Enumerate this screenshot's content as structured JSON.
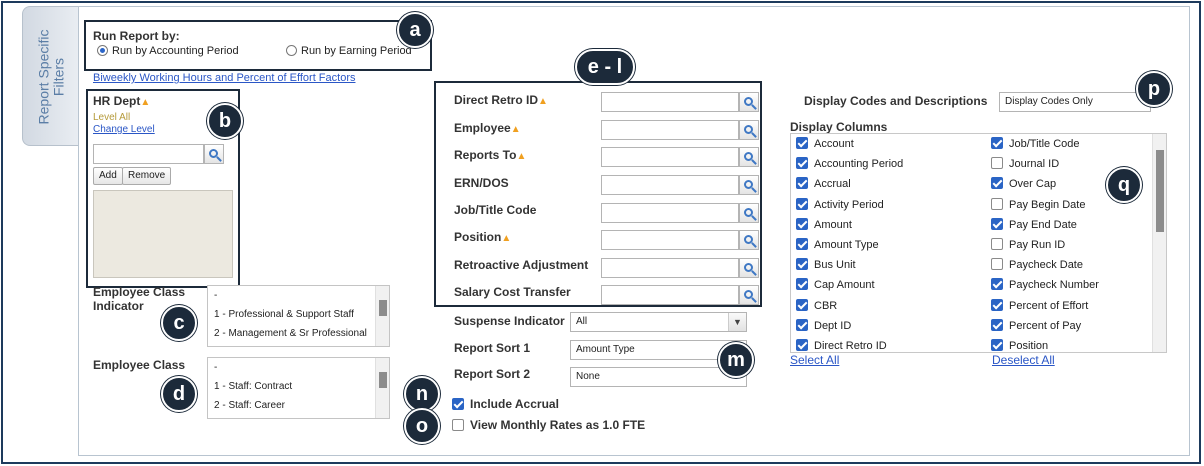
{
  "side_tab": {
    "label": "Report Specific\nFilters"
  },
  "run_report": {
    "title": "Run Report by:",
    "options": [
      "Run by Accounting Period",
      "Run by Earning Period"
    ],
    "selected": 0
  },
  "factors_link": "Biweekly Working Hours and Percent of Effort Factors",
  "hr_dept": {
    "label": "HR Dept",
    "warn": "▲",
    "level_text": "Level All",
    "change_level": "Change Level",
    "input_value": "",
    "add_label": "Add",
    "remove_label": "Remove"
  },
  "employee_class_indicator": {
    "label": "Employee Class Indicator",
    "options": [
      "-",
      "1 - Professional & Support Staff",
      "2 - Management & Sr Professional"
    ]
  },
  "employee_class": {
    "label": "Employee Class",
    "options": [
      "-",
      "1 - Staff: Contract",
      "2 - Staff: Career"
    ]
  },
  "fields": [
    {
      "label": "Direct Retro ID",
      "warn": "▲",
      "value": ""
    },
    {
      "label": "Employee",
      "warn": "▲",
      "value": ""
    },
    {
      "label": "Reports To",
      "warn": "▲",
      "value": ""
    },
    {
      "label": "ERN/DOS",
      "warn": "",
      "value": ""
    },
    {
      "label": "Job/Title Code",
      "warn": "",
      "value": ""
    },
    {
      "label": "Position",
      "warn": "▲",
      "value": ""
    },
    {
      "label": "Retroactive Adjustment",
      "warn": "",
      "value": ""
    },
    {
      "label": "Salary Cost Transfer",
      "warn": "",
      "value": ""
    }
  ],
  "suspense": {
    "label": "Suspense Indicator",
    "value": "All",
    "arrow": "▼"
  },
  "sort1": {
    "label": "Report Sort 1",
    "value": "Amount Type"
  },
  "sort2": {
    "label": "Report Sort 2",
    "value": "None"
  },
  "include_accrual": {
    "label": "Include Accrual",
    "checked": true
  },
  "monthly_rates": {
    "label": "View Monthly Rates as 1.0 FTE",
    "checked": false
  },
  "display_codes": {
    "label": "Display Codes and Descriptions",
    "value": "Display Codes Only"
  },
  "display_columns": {
    "label": "Display Columns",
    "left": [
      {
        "name": "Account",
        "checked": true
      },
      {
        "name": "Accounting Period",
        "checked": true
      },
      {
        "name": "Accrual",
        "checked": true
      },
      {
        "name": "Activity Period",
        "checked": true
      },
      {
        "name": "Amount",
        "checked": true
      },
      {
        "name": "Amount Type",
        "checked": true
      },
      {
        "name": "Bus Unit",
        "checked": true
      },
      {
        "name": "Cap Amount",
        "checked": true
      },
      {
        "name": "CBR",
        "checked": true
      },
      {
        "name": "Dept ID",
        "checked": true
      },
      {
        "name": "Direct Retro ID",
        "checked": true
      }
    ],
    "right": [
      {
        "name": "Job/Title Code",
        "checked": true
      },
      {
        "name": "Journal ID",
        "checked": false
      },
      {
        "name": "Over Cap",
        "checked": true
      },
      {
        "name": "Pay Begin Date",
        "checked": false
      },
      {
        "name": "Pay End Date",
        "checked": true
      },
      {
        "name": "Pay Run ID",
        "checked": false
      },
      {
        "name": "Paycheck Date",
        "checked": false
      },
      {
        "name": "Paycheck Number",
        "checked": true
      },
      {
        "name": "Percent of Effort",
        "checked": true
      },
      {
        "name": "Percent of Pay",
        "checked": true
      },
      {
        "name": "Position",
        "checked": true
      }
    ],
    "select_all": "Select All",
    "deselect_all": "Deselect All"
  },
  "badges": {
    "a": "a",
    "b": "b",
    "c": "c",
    "d": "d",
    "el": "e - l",
    "m": "m",
    "n": "n",
    "o": "o",
    "p": "p",
    "q": "q"
  }
}
